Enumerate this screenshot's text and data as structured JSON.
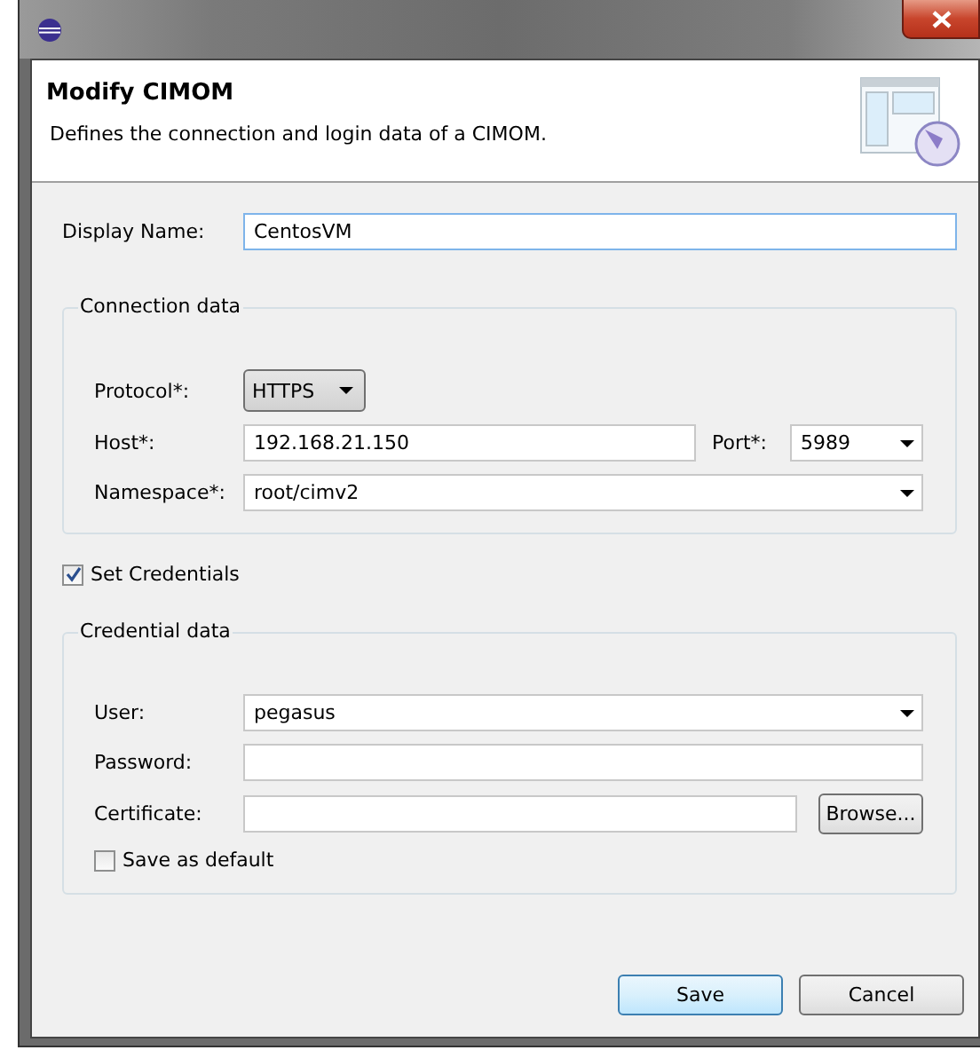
{
  "header": {
    "title": "Modify CIMOM",
    "description": "Defines the connection and login data of a CIMOM."
  },
  "display_name": {
    "label": "Display Name:",
    "value": "CentosVM"
  },
  "connection": {
    "title": "Connection data",
    "protocol": {
      "label": "Protocol*:",
      "value": "HTTPS"
    },
    "host": {
      "label": "Host*:",
      "value": "192.168.21.150"
    },
    "port": {
      "label": "Port*:",
      "value": "5989"
    },
    "namespace": {
      "label": "Namespace*:",
      "value": "root/cimv2"
    }
  },
  "set_credentials": {
    "label": "Set Credentials",
    "checked": true
  },
  "credentials": {
    "title": "Credential data",
    "user": {
      "label": "User:",
      "value": "pegasus"
    },
    "password": {
      "label": "Password:"
    },
    "certificate": {
      "label": "Certificate:"
    },
    "browse": "Browse...",
    "save_default": {
      "label": "Save as default",
      "checked": false
    }
  },
  "buttons": [
    {
      "label": "Save",
      "focused": true
    },
    {
      "label": "Cancel",
      "focused": false
    }
  ]
}
